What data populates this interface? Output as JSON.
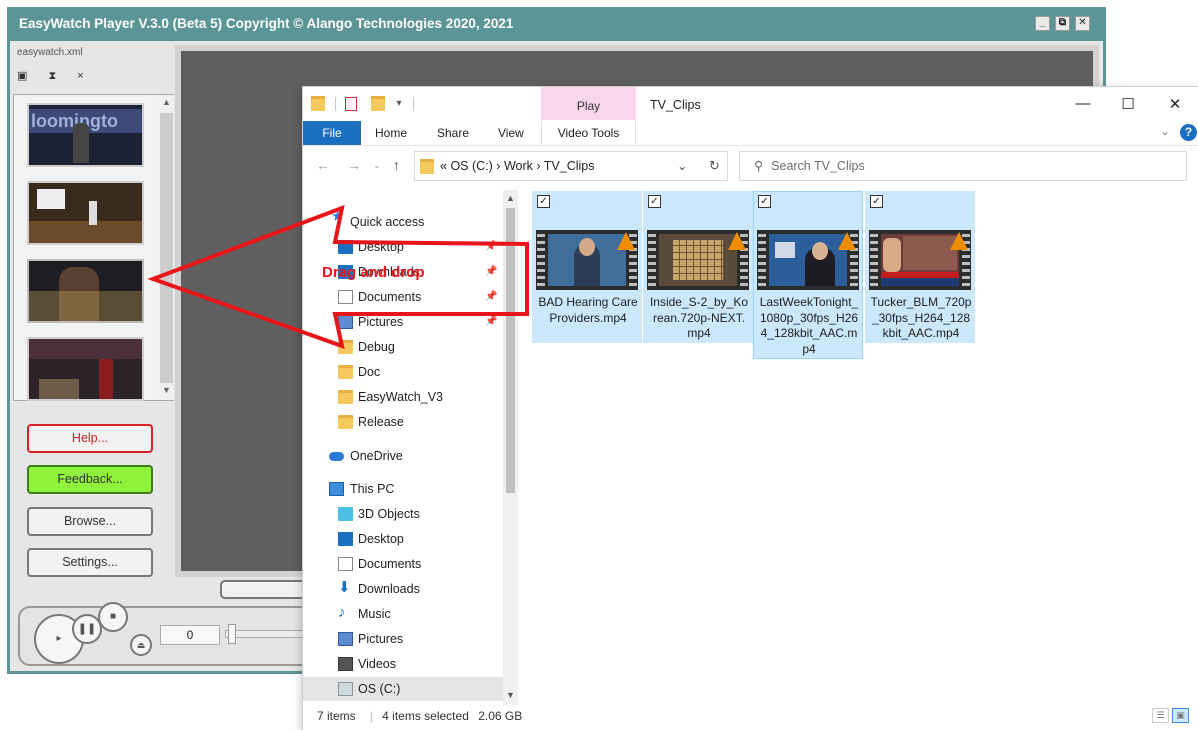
{
  "player": {
    "title": "EasyWatch Player V.3.0 (Beta 5) Copyright © Alango Technologies 2020, 2021",
    "window_buttons": [
      "_",
      "⧉",
      "✕"
    ],
    "playlist_file": "easywatch.xml",
    "tool_icons": "▣ ⧗ ×",
    "thumb1_caption": "loomingto",
    "buttons": {
      "help": "Help...",
      "feedback": "Feedback...",
      "browse": "Browse...",
      "settings": "Settings..."
    },
    "colors": {
      "help_border": "#d8222a",
      "feedback_fill": "#8ff33c",
      "frame": "#5c9595"
    },
    "counter": "0"
  },
  "explorer": {
    "context_tab": "Play",
    "window_title": "TV_Clips",
    "caption_buttons": [
      "—",
      "☐",
      "✕"
    ],
    "ribbon": {
      "file": "File",
      "home": "Home",
      "share": "Share",
      "view": "View",
      "video_tools": "Video Tools"
    },
    "address": {
      "prefix": "«",
      "drive": "OS (C:)",
      "sep1": "›",
      "folder1": "Work",
      "sep2": "›",
      "folder2": "TV_Clips"
    },
    "search_placeholder": "Search TV_Clips",
    "nav_items": [
      {
        "label": "Quick access",
        "icon": "star-icon"
      },
      {
        "label": "Desktop",
        "icon": "desktop-icon",
        "pinned": true
      },
      {
        "label": "Downloads",
        "icon": "downloads-icon",
        "pinned": true
      },
      {
        "label": "Documents",
        "icon": "documents-icon",
        "pinned": true
      },
      {
        "label": "Pictures",
        "icon": "pictures-icon",
        "pinned": true
      },
      {
        "label": "Debug",
        "icon": "folder-icon"
      },
      {
        "label": "Doc",
        "icon": "folder-icon"
      },
      {
        "label": "EasyWatch_V3",
        "icon": "folder-icon"
      },
      {
        "label": "Release",
        "icon": "folder-icon"
      },
      {
        "label": "OneDrive",
        "icon": "cloud-icon"
      },
      {
        "label": "This PC",
        "icon": "pc-icon"
      },
      {
        "label": "3D Objects",
        "icon": "cube-icon"
      },
      {
        "label": "Desktop",
        "icon": "desktop-icon"
      },
      {
        "label": "Documents",
        "icon": "documents-icon"
      },
      {
        "label": "Downloads",
        "icon": "downloads-icon"
      },
      {
        "label": "Music",
        "icon": "music-icon"
      },
      {
        "label": "Pictures",
        "icon": "pictures-icon"
      },
      {
        "label": "Videos",
        "icon": "videos-icon"
      },
      {
        "label": "OS (C:)",
        "icon": "drive-icon"
      }
    ],
    "files": [
      {
        "name": "BAD Hearing Care Providers.mp4",
        "checked": true
      },
      {
        "name": "Inside_S-2_by_Korean.720p-NEXT.mp4",
        "checked": true
      },
      {
        "name": "LastWeekTonight_1080p_30fps_H264_128kbit_AAC.mp4",
        "checked": true
      },
      {
        "name": "Tucker_BLM_720p_30fps_H264_128kbit_AAC.mp4",
        "checked": true
      }
    ],
    "status": {
      "items": "7 items",
      "selected": "4 items selected",
      "size": "2.06 GB"
    },
    "selection_color": "#cce8ff"
  },
  "annotation": {
    "text": "Drag and drop",
    "color": "#e8161a"
  }
}
